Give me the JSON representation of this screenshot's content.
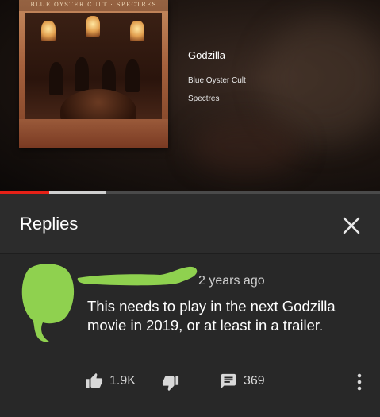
{
  "video": {
    "album_cover_text": "BLUE OYSTER CULT · SPECTRES",
    "track_title": "Godzilla",
    "artist": "Blue Oyster Cult",
    "album": "Spectres",
    "progress_played_fraction": 0.13,
    "progress_buffered_fraction": 0.28,
    "colors": {
      "played": "#e62117",
      "buffer": "#cfcfcf",
      "track": "#4a4a4a"
    }
  },
  "replies_panel": {
    "title": "Replies",
    "close_icon": "close-icon"
  },
  "comment": {
    "timestamp": "2 years ago",
    "text": "This needs to play in the next Godzilla movie in 2019, or at least in a trailer.",
    "like_count": "1.9K",
    "reply_count": "369",
    "icons": [
      "thumbs-up-icon",
      "thumbs-down-icon",
      "reply-icon",
      "more-vert-icon"
    ],
    "redaction_color": "#8fd14f"
  }
}
